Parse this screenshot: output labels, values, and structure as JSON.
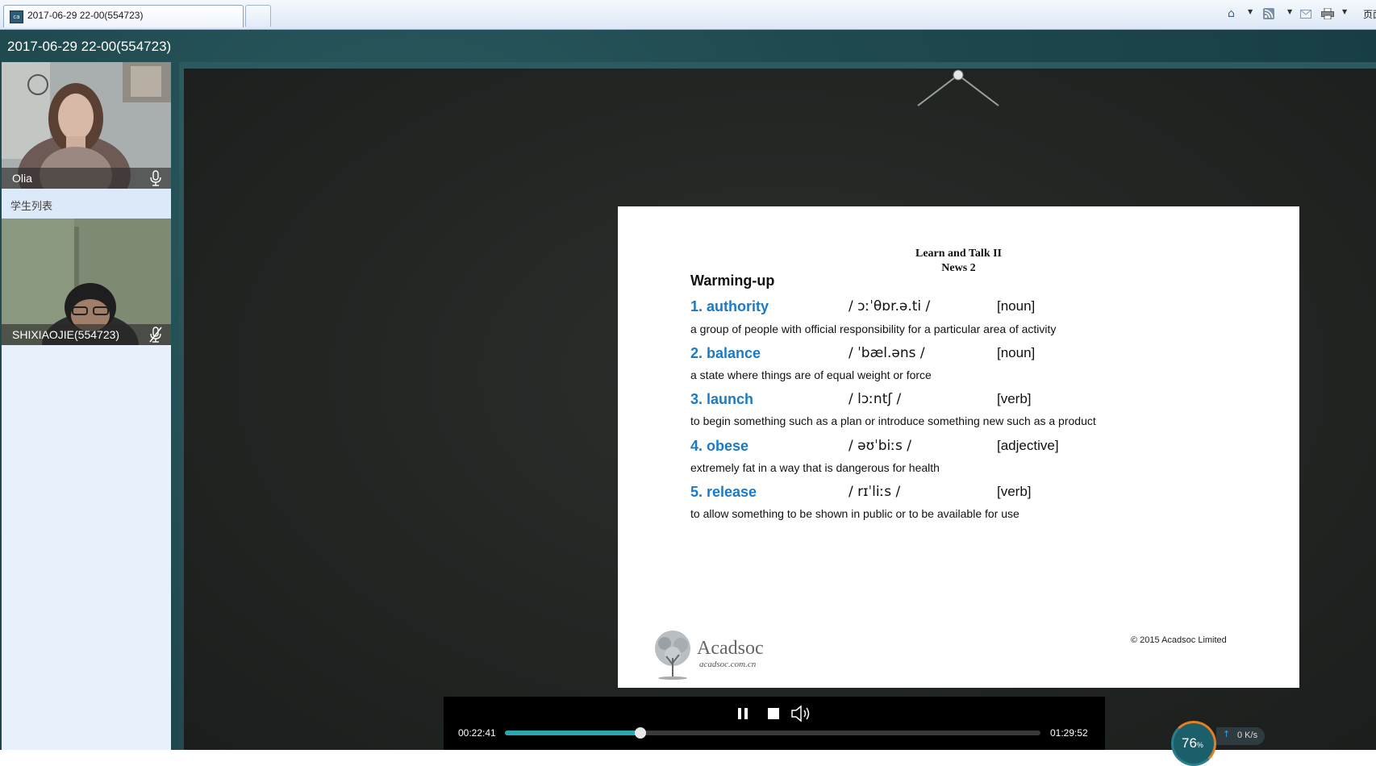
{
  "browser": {
    "tab_title": "2017-06-29 22-00(554723)",
    "favicon_text": "ca",
    "page_menu_label": "页面",
    "toolbar_icons": [
      "home-icon",
      "rss-icon",
      "mail-icon",
      "print-icon"
    ]
  },
  "app": {
    "session_title": "2017-06-29 22-00(554723)",
    "teacher": {
      "name": "Olia",
      "mic_state": "on"
    },
    "student_list_label": "学生列表",
    "student": {
      "name": "SHIXIAOJIE(554723)",
      "mic_state": "muted"
    }
  },
  "slide": {
    "title_line1": "Learn and Talk II",
    "title_line2": "News 2",
    "heading": "Warming-up",
    "words": [
      {
        "num_word": "1. authority",
        "pron": "/ ɔːˈθɒr.ə.ti /",
        "pos": "[noun]",
        "definition": "a group of people with official responsibility for a particular area of activity"
      },
      {
        "num_word": "2. balance",
        "pron": "/ ˈbæl.əns /",
        "pos": "[noun]",
        "definition": "a state where things are of equal weight or force"
      },
      {
        "num_word": "3. launch",
        "pron": "/ lɔːntʃ /",
        "pos": "[verb]",
        "definition": "to begin something such as a plan or introduce something new such as a product"
      },
      {
        "num_word": "4. obese",
        "pron": "/ əʊˈbiːs /",
        "pos": "[adjective]",
        "definition": "extremely fat in a way that is dangerous for health"
      },
      {
        "num_word": "5. release",
        "pron": "/ rɪˈliːs /",
        "pos": "[verb]",
        "definition": "to allow something to be shown in public or to be available for use"
      }
    ],
    "logo_name": "Acadsoc",
    "logo_url": "acadsoc.com.cn",
    "copyright": "© 2015 Acadsoc Limited"
  },
  "player": {
    "current_time": "00:22:41",
    "total_time": "01:29:52",
    "progress": 0.2524,
    "progress_color": "#2aa6b1"
  },
  "network": {
    "percent": "76",
    "percent_unit": "%",
    "speed": "0 K/s"
  },
  "colors": {
    "accent_blue": "#1a7ac6",
    "board_frame": "#24494f",
    "chalkboard": "#222623"
  }
}
